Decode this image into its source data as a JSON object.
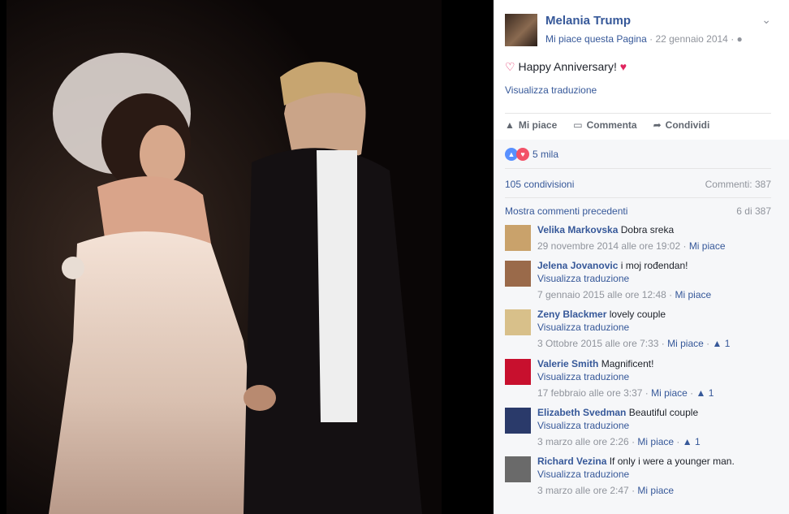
{
  "post": {
    "page_name": "Melania Trump",
    "like_page": "Mi piace questa Pagina",
    "date": "22 gennaio 2014",
    "text": "Happy Anniversary!",
    "translate": "Visualizza traduzione",
    "actions": {
      "like": "Mi piace",
      "comment": "Commenta",
      "share": "Condividi"
    },
    "reactions_count": "5 mila",
    "shares": "105 condivisioni",
    "comments_count": "Commenti: 387",
    "previous_comments": "Mostra commenti precedenti",
    "comments_shown": "6 di 387"
  },
  "comments": [
    {
      "author": "Velika Markovska",
      "text": "Dobra sreka",
      "translate": "",
      "date": "29 novembre 2014 alle ore 19:02",
      "like": "Mi piace",
      "likes": "",
      "avatar_color": "#c9a26b"
    },
    {
      "author": "Jelena Jovanovic",
      "text": "i moj rođendan!",
      "translate": "Visualizza traduzione",
      "date": "7 gennaio 2015 alle ore 12:48",
      "like": "Mi piace",
      "likes": "",
      "avatar_color": "#9a6a4a"
    },
    {
      "author": "Zeny Blackmer",
      "text": "lovely couple",
      "translate": "Visualizza traduzione",
      "date": "3 Ottobre 2015 alle ore 7:33",
      "like": "Mi piace",
      "likes": "1",
      "avatar_color": "#d8c08a"
    },
    {
      "author": "Valerie Smith",
      "text": "Magnificent!",
      "translate": "Visualizza traduzione",
      "date": "17 febbraio alle ore 3:37",
      "like": "Mi piace",
      "likes": "1",
      "avatar_color": "#c8102e"
    },
    {
      "author": "Elizabeth Svedman",
      "text": "Beautiful couple",
      "translate": "Visualizza traduzione",
      "date": "3 marzo alle ore 2:26",
      "like": "Mi piace",
      "likes": "1",
      "avatar_color": "#2a3a6a"
    },
    {
      "author": "Richard Vezina",
      "text": "If only i were a younger man.",
      "translate": "Visualizza traduzione",
      "date": "3 marzo alle ore 2:47",
      "like": "Mi piace",
      "likes": "",
      "avatar_color": "#6a6a6a"
    }
  ]
}
